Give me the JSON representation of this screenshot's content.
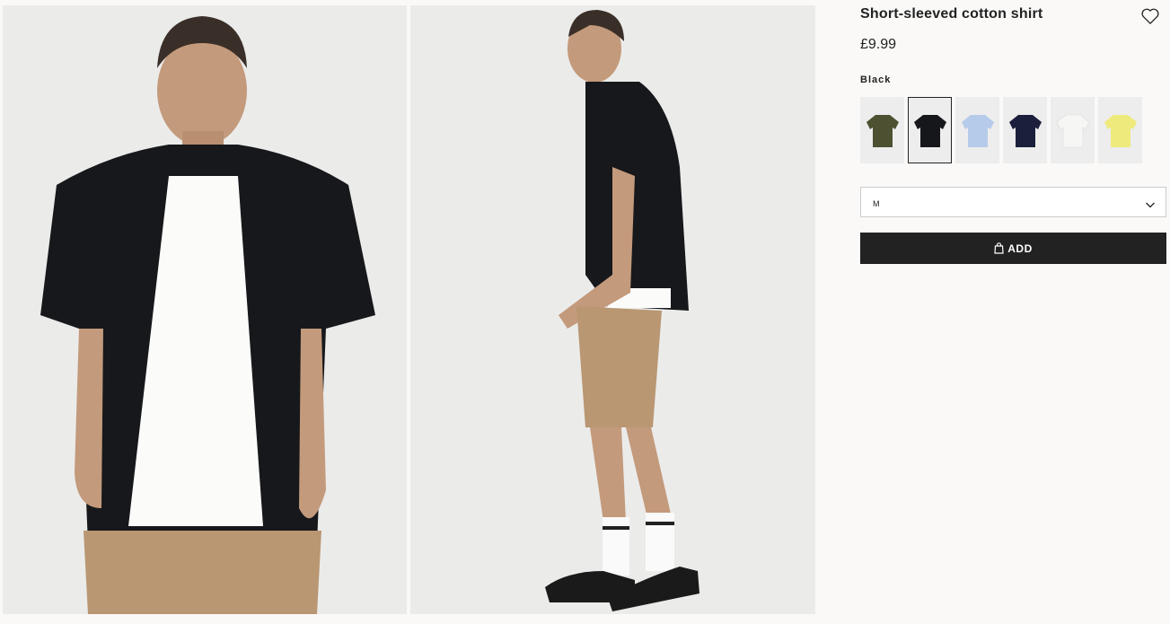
{
  "product": {
    "title": "Short-sleeved cotton shirt",
    "price": "£9.99",
    "selected_colour": "Black"
  },
  "swatches": [
    {
      "name": "Khaki green",
      "color": "#4d5132",
      "selected": false
    },
    {
      "name": "Black",
      "color": "#16171a",
      "selected": true
    },
    {
      "name": "Light blue",
      "color": "#b6cbe9",
      "selected": false
    },
    {
      "name": "Dark blue",
      "color": "#1b1f3c",
      "selected": false
    },
    {
      "name": "White",
      "color": "#f6f6f4",
      "selected": false
    },
    {
      "name": "Light yellow",
      "color": "#efea7c",
      "selected": false
    }
  ],
  "size_select": {
    "value": "M"
  },
  "add_button": {
    "label": "ADD"
  },
  "icons": {
    "favourite": "heart-icon",
    "dropdown": "chevron-down-icon",
    "bag": "shopping-bag-icon"
  }
}
